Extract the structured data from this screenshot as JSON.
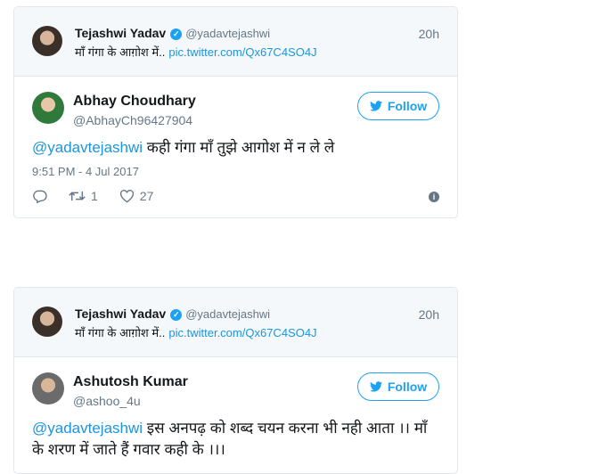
{
  "tweets": [
    {
      "quoted": {
        "name": "Tejashwi Yadav",
        "handle": "@yadavtejashwi",
        "time": "20h",
        "text": "माँ गंगा के आग़ोश में..",
        "link": "pic.twitter.com/Qx67C4SO4J"
      },
      "user": {
        "name": "Abhay Choudhary",
        "handle": "@AbhayCh96427904"
      },
      "follow_label": "Follow",
      "mention": "@yadavtejashwi",
      "text": "कही गंगा माँ तुझे आगोश में न ले ले",
      "timestamp": "9:51 PM - 4 Jul 2017",
      "retweets": "1",
      "likes": "27"
    },
    {
      "quoted": {
        "name": "Tejashwi Yadav",
        "handle": "@yadavtejashwi",
        "time": "20h",
        "text": "माँ गंगा के आग़ोश में..",
        "link": "pic.twitter.com/Qx67C4SO4J"
      },
      "user": {
        "name": "Ashutosh Kumar",
        "handle": "@ashoo_4u"
      },
      "follow_label": "Follow",
      "mention": "@yadavtejashwi",
      "text": "इस अनपढ़ को शब्द चयन करना भी नही आता ।। माँ के शरण में जाते हैं गवार कही के ।।।"
    }
  ],
  "colors": {
    "accent": "#1da1f2",
    "link": "#1b95e0",
    "muted": "#657786",
    "border": "#e1e8ed"
  },
  "icons": [
    "verified-badge-icon",
    "twitter-bird-icon",
    "reply-icon",
    "retweet-icon",
    "like-icon",
    "info-icon"
  ]
}
